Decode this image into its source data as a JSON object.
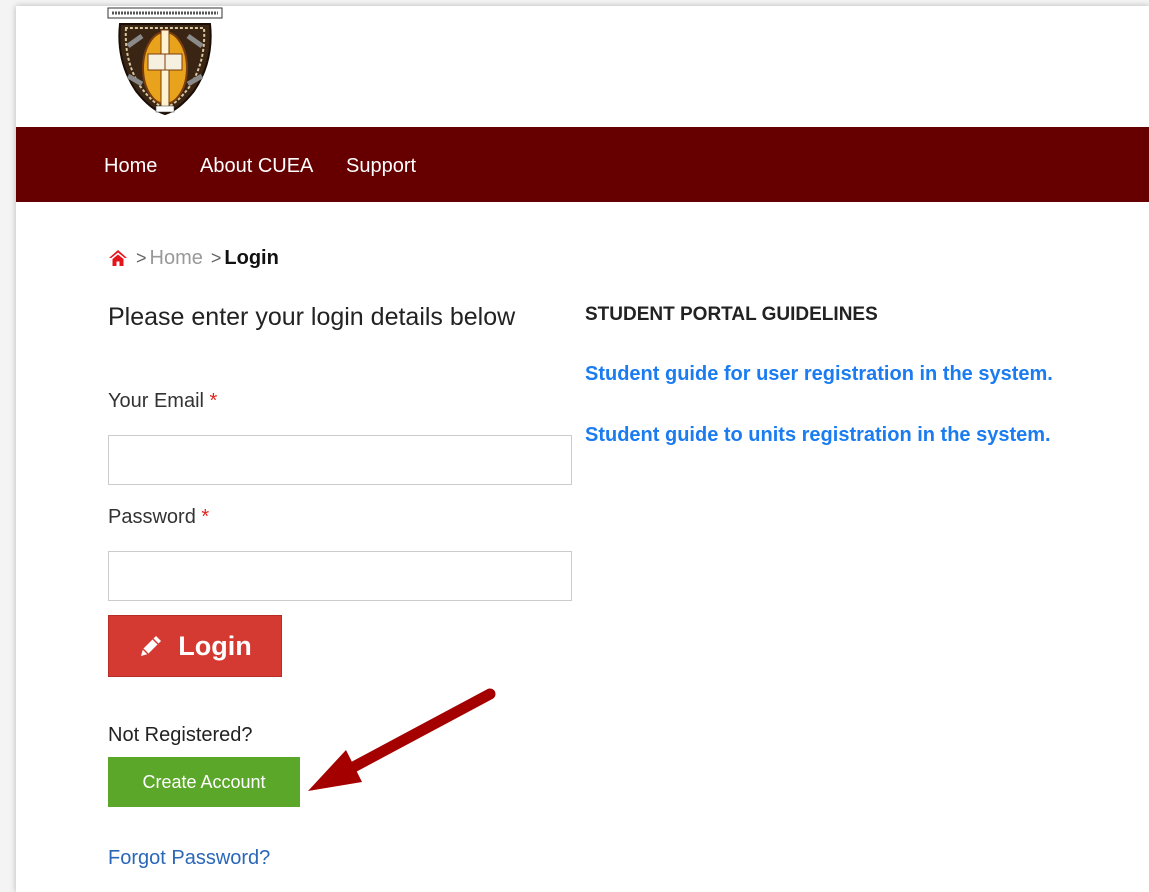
{
  "logo": {
    "text": "THE CATHOLIC UNIVERSITY OF EASTERN AFRICA"
  },
  "nav": {
    "items": [
      "Home",
      "About CUEA",
      "Support"
    ]
  },
  "breadcrumb": {
    "home": "Home",
    "current": "Login",
    "separator": ">"
  },
  "form": {
    "title": "Please enter your login details below",
    "email_label": "Your Email",
    "password_label": "Password",
    "required_mark": "*",
    "email_value": "",
    "password_value": "",
    "login_label": "Login",
    "not_registered": "Not Registered?",
    "create_account_label": "Create Account",
    "forgot_password": "Forgot Password?"
  },
  "guidelines": {
    "title": "STUDENT PORTAL GUIDELINES",
    "links": [
      "Student guide for user registration in the system.",
      "Student guide to units registration in the system."
    ]
  },
  "colors": {
    "navbar": "#660000",
    "login_button": "#d43a32",
    "create_button": "#5ba72a",
    "link_blue": "#1a7cf0",
    "arrow": "#a40000"
  }
}
